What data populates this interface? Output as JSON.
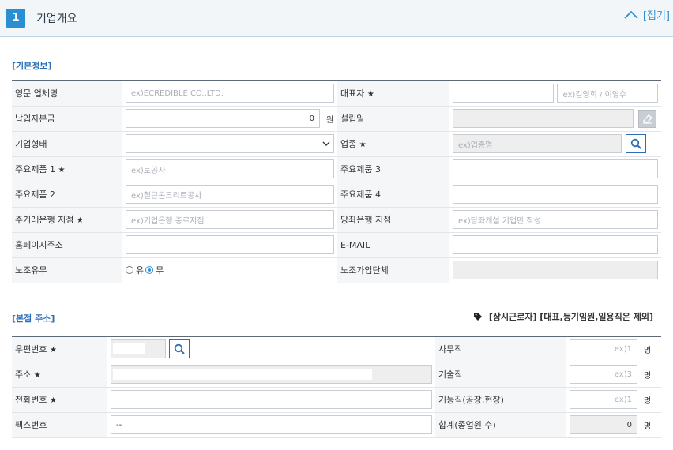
{
  "section": {
    "number": "1",
    "title": "기업개요",
    "fold_label": "[접기]"
  },
  "basic": {
    "title": "[기본정보]",
    "eng_name_label": "영문 업체명",
    "eng_name_placeholder": "ex)ECREDIBLE CO.,LTD.",
    "ceo_label": "대표자",
    "ceo_star": "★",
    "ceo_placeholder": "ex)김영희 / 이영수",
    "capital_label": "납입자본금",
    "capital_value": "0",
    "capital_unit": "원",
    "founded_label": "설립일",
    "type_label": "기업형태",
    "industry_label": "업종",
    "industry_star": "★",
    "industry_placeholder": "ex)업종명",
    "product1_label": "주요제품 1",
    "product1_star": "★",
    "product1_placeholder": "ex)토공사",
    "product3_label": "주요제품 3",
    "product2_label": "주요제품 2",
    "product2_placeholder": "ex)철근콘크리트공사",
    "product4_label": "주요제품 4",
    "bank_label": "주거래은행 지점",
    "bank_star": "★",
    "bank_placeholder": "ex)기업은행 종로지점",
    "acct_bank_label": "당좌은행 지점",
    "acct_bank_placeholder": "ex)당좌개설 기업만 작성",
    "homepage_label": "홈페이지주소",
    "email_label": "E-MAIL",
    "union_label": "노조유무",
    "union_yes": "유",
    "union_no": "무",
    "union_org_label": "노조가입단체"
  },
  "hq": {
    "title": "[본점 주소]",
    "note": "[상시근로자] [대표,등기임원,일용직은 제외]",
    "zip_label": "우편번호",
    "zip_star": "★",
    "addr_label": "주소",
    "addr_star": "★",
    "phone_label": "전화번호",
    "phone_star": "★",
    "fax_label": "팩스번호",
    "fax_value": "--",
    "office_label": "사무직",
    "office_placeholder": "ex)1",
    "office_unit": "명",
    "tech_label": "기술직",
    "tech_placeholder": "ex)3",
    "tech_unit": "명",
    "skill_label": "기능직(공장,현장)",
    "skill_placeholder": "ex)1",
    "skill_unit": "명",
    "total_label": "합계(종업원 수)",
    "total_value": "0",
    "total_unit": "명"
  },
  "colors": {
    "accent": "#2a8fd2",
    "link": "#2a6fb6"
  }
}
